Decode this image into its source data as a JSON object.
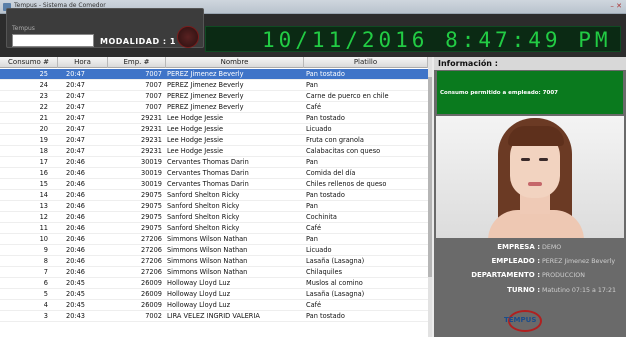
{
  "window": {
    "title": "Tempus - Sistema de Comedor",
    "controls": "– ✕"
  },
  "header": {
    "small_label": "Tempus",
    "input_value": "",
    "modalidad_label": "MODALIDAD :",
    "modalidad_value": "1",
    "clock": "10/11/2016 8:47:49 PM"
  },
  "table": {
    "columns": [
      "Consumo #",
      "Hora",
      "Emp. #",
      "Nombre",
      "Platillo"
    ],
    "rows": [
      [
        "25",
        "20:47",
        "7007",
        "PEREZ Jimenez Beverly",
        "Pan tostado"
      ],
      [
        "24",
        "20:47",
        "7007",
        "PEREZ Jimenez Beverly",
        "Pan"
      ],
      [
        "23",
        "20:47",
        "7007",
        "PEREZ Jimenez Beverly",
        "Carne de puerco en chile"
      ],
      [
        "22",
        "20:47",
        "7007",
        "PEREZ Jimenez Beverly",
        "Café"
      ],
      [
        "21",
        "20:47",
        "29231",
        "Lee Hodge Jessie",
        "Pan tostado"
      ],
      [
        "20",
        "20:47",
        "29231",
        "Lee Hodge Jessie",
        "Licuado"
      ],
      [
        "19",
        "20:47",
        "29231",
        "Lee Hodge Jessie",
        "Fruta con granola"
      ],
      [
        "18",
        "20:47",
        "29231",
        "Lee Hodge Jessie",
        "Calabacitas con queso"
      ],
      [
        "17",
        "20:46",
        "30019",
        "Cervantes Thomas Darin",
        "Pan"
      ],
      [
        "16",
        "20:46",
        "30019",
        "Cervantes Thomas Darin",
        "Comida del día"
      ],
      [
        "15",
        "20:46",
        "30019",
        "Cervantes Thomas Darin",
        "Chiles rellenos de queso"
      ],
      [
        "14",
        "20:46",
        "29075",
        "Sanford Shelton Ricky",
        "Pan tostado"
      ],
      [
        "13",
        "20:46",
        "29075",
        "Sanford Shelton Ricky",
        "Pan"
      ],
      [
        "12",
        "20:46",
        "29075",
        "Sanford Shelton Ricky",
        "Cochinita"
      ],
      [
        "11",
        "20:46",
        "29075",
        "Sanford Shelton Ricky",
        "Café"
      ],
      [
        "10",
        "20:46",
        "27206",
        "Simmons Wilson Nathan",
        "Pan"
      ],
      [
        "9",
        "20:46",
        "27206",
        "Simmons Wilson Nathan",
        "Licuado"
      ],
      [
        "8",
        "20:46",
        "27206",
        "Simmons Wilson Nathan",
        "Lasaña (Lasagna)"
      ],
      [
        "7",
        "20:46",
        "27206",
        "Simmons Wilson Nathan",
        "Chilaquiles"
      ],
      [
        "6",
        "20:45",
        "26009",
        "Holloway Lloyd Luz",
        "Muslos al comino"
      ],
      [
        "5",
        "20:45",
        "26009",
        "Holloway Lloyd Luz",
        "Lasaña (Lasagna)"
      ],
      [
        "4",
        "20:45",
        "26009",
        "Holloway Lloyd Luz",
        "Café"
      ],
      [
        "3",
        "20:43",
        "7002",
        "LIRA VELEZ INGRID VALERIA",
        "Pan tostado"
      ]
    ],
    "selected_index": 0
  },
  "info": {
    "title": "Información :",
    "message": "Consumo permitido a empleado: 7007",
    "empresa_label": "EMPRESA :",
    "empresa_value": "DEMO",
    "empleado_label": "EMPLEADO :",
    "empleado_value": "PEREZ Jimenez Beverly",
    "departamento_label": "DEPARTAMENTO :",
    "departamento_value": "PRODUCCION",
    "turno_label": "TURNO :",
    "turno_value": "Matutino 07:15 a 17:21",
    "logo_text": "TEMPUS"
  },
  "colors": {
    "selection": "#3f74c8",
    "clock_green": "#22cc44",
    "message_bg": "#0a7a1e"
  }
}
